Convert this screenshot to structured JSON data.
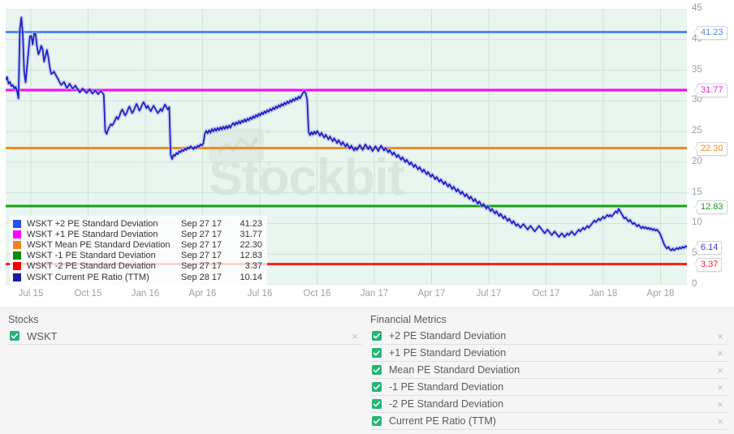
{
  "chart_data": {
    "type": "line",
    "title": "",
    "xlabel": "",
    "ylabel": "",
    "ylim": [
      0,
      45
    ],
    "y_ticks": [
      45,
      40,
      35,
      30,
      25,
      20,
      15,
      10,
      5,
      0
    ],
    "x_ticks": [
      "Jul 15",
      "Oct 15",
      "Jan 16",
      "Apr 16",
      "Jul 16",
      "Oct 16",
      "Jan 17",
      "Apr 17",
      "Jul 17",
      "Oct 17",
      "Jan 18",
      "Apr 18"
    ],
    "grid": true,
    "plot_background": "#e9f5ef",
    "legend_position": "inside-bottom-left",
    "watermark": "Stockbit",
    "reference_lines": [
      {
        "name": "WSKT +2 PE Standard Deviation",
        "value": 41.23,
        "color": "#4f86f7"
      },
      {
        "name": "WSKT +1 PE Standard Deviation",
        "value": 31.77,
        "color": "#ff00ff"
      },
      {
        "name": "WSKT Mean PE Standard Deviation",
        "value": 22.3,
        "color": "#f08a24"
      },
      {
        "name": "WSKT -1 PE Standard Deviation",
        "value": 12.83,
        "color": "#16a016"
      },
      {
        "name": "WSKT -2 PE Standard Deviation",
        "value": 3.37,
        "color": "#fa1f1f"
      }
    ],
    "series": [
      {
        "name": "WSKT Current PE Ratio (TTM)",
        "color": "#1f1fc8",
        "last_value": 6.14,
        "values": [
          33.4,
          33.9,
          32.8,
          33.1,
          32.4,
          32.6,
          32.0,
          32.3,
          31.6,
          30.4,
          41.8,
          43.6,
          41.0,
          34.8,
          33.0,
          35.5,
          38.0,
          40.5,
          40.6,
          39.2,
          41.0,
          40.9,
          38.9,
          37.6,
          38.1,
          39.0,
          38.4,
          36.4,
          37.4,
          38.3,
          37.1,
          35.5,
          34.4,
          34.5,
          34.8,
          34.3,
          33.9,
          33.5,
          33.0,
          32.6,
          32.8,
          33.1,
          32.6,
          32.1,
          32.4,
          32.8,
          32.4,
          32.0,
          32.2,
          32.5,
          32.1,
          31.8,
          31.4,
          31.6,
          32.0,
          31.8,
          31.5,
          31.3,
          31.6,
          31.9,
          31.5,
          31.2,
          31.4,
          31.7,
          31.4,
          31.1,
          31.4,
          31.6,
          31.3,
          31.0,
          25.0,
          24.6,
          25.3,
          25.8,
          26.2,
          26.0,
          26.4,
          26.9,
          27.4,
          27.0,
          27.5,
          28.2,
          28.6,
          28.1,
          27.6,
          28.0,
          28.6,
          29.1,
          28.5,
          28.0,
          28.4,
          29.0,
          29.5,
          29.0,
          28.4,
          28.8,
          29.4,
          29.8,
          29.3,
          28.8,
          29.2,
          28.7,
          28.3,
          28.8,
          29.2,
          28.8,
          28.4,
          28.0,
          28.3,
          28.7,
          28.3,
          28.9,
          29.4,
          29.0,
          28.6,
          29.0,
          21.2,
          20.5,
          21.2,
          21.0,
          21.5,
          21.3,
          21.8,
          21.6,
          22.0,
          21.8,
          22.2,
          22.0,
          22.4,
          22.2,
          22.6,
          22.4,
          22.1,
          22.5,
          22.3,
          22.7,
          22.5,
          22.9,
          22.7,
          23.1,
          24.6,
          25.1,
          24.7,
          25.2,
          24.8,
          25.4,
          25.0,
          25.5,
          25.1,
          25.6,
          25.2,
          25.7,
          25.3,
          25.8,
          25.4,
          25.9,
          25.5,
          26.0,
          25.6,
          26.1,
          26.4,
          26.0,
          26.5,
          26.2,
          26.7,
          26.3,
          26.8,
          26.5,
          27.0,
          26.6,
          27.1,
          26.8,
          27.3,
          27.0,
          27.5,
          27.2,
          27.7,
          27.4,
          27.9,
          27.6,
          28.1,
          27.8,
          28.3,
          28.0,
          28.5,
          28.2,
          28.7,
          28.4,
          28.9,
          28.6,
          29.1,
          28.8,
          29.3,
          29.0,
          29.5,
          29.2,
          29.7,
          29.4,
          29.9,
          29.6,
          30.1,
          29.8,
          30.3,
          30.0,
          30.5,
          30.2,
          30.7,
          30.4,
          30.9,
          31.3,
          31.6,
          31.2,
          30.2,
          24.9,
          24.4,
          24.9,
          24.5,
          25.0,
          24.6,
          25.1,
          24.7,
          24.3,
          24.8,
          24.4,
          24.0,
          24.5,
          24.1,
          23.7,
          24.2,
          23.8,
          23.4,
          23.9,
          23.5,
          23.1,
          23.6,
          23.2,
          22.8,
          23.3,
          22.9,
          22.5,
          23.0,
          22.6,
          22.2,
          22.7,
          22.3,
          21.9,
          22.4,
          22.0,
          22.4,
          22.8,
          22.4,
          22.0,
          22.5,
          22.9,
          22.5,
          22.1,
          22.6,
          22.2,
          21.8,
          22.2,
          22.6,
          22.2,
          21.8,
          22.3,
          22.7,
          22.3,
          21.9,
          22.3,
          22.0,
          21.6,
          22.0,
          21.6,
          21.2,
          21.6,
          21.2,
          20.8,
          21.2,
          20.8,
          20.4,
          20.8,
          20.4,
          20.0,
          20.4,
          20.0,
          19.6,
          20.0,
          19.6,
          19.2,
          19.6,
          19.2,
          18.8,
          19.2,
          18.8,
          18.4,
          18.8,
          18.4,
          18.0,
          18.4,
          18.0,
          17.6,
          18.0,
          17.6,
          17.2,
          17.6,
          17.2,
          16.8,
          17.2,
          16.8,
          16.4,
          16.8,
          16.4,
          16.0,
          16.4,
          16.0,
          15.6,
          16.0,
          15.6,
          15.2,
          15.6,
          15.2,
          14.8,
          15.2,
          14.8,
          14.4,
          14.8,
          14.4,
          14.0,
          14.4,
          14.0,
          13.6,
          14.0,
          13.6,
          13.2,
          13.6,
          13.2,
          12.8,
          13.2,
          12.8,
          12.4,
          12.8,
          12.4,
          12.0,
          12.4,
          12.0,
          11.6,
          12.0,
          11.6,
          11.2,
          11.6,
          11.2,
          10.8,
          11.2,
          10.8,
          10.4,
          10.8,
          10.4,
          10.0,
          10.4,
          10.0,
          9.6,
          9.9,
          9.6,
          9.3,
          9.6,
          9.9,
          9.6,
          9.3,
          9.0,
          9.3,
          9.6,
          9.3,
          9.0,
          8.7,
          9.0,
          9.3,
          9.6,
          9.3,
          9.0,
          8.7,
          8.4,
          8.7,
          9.0,
          8.7,
          8.4,
          8.1,
          8.4,
          8.7,
          8.4,
          8.1,
          7.8,
          8.1,
          8.4,
          8.1,
          7.8,
          8.1,
          8.4,
          8.1,
          8.4,
          8.7,
          8.4,
          8.1,
          8.4,
          8.7,
          9.0,
          8.7,
          9.0,
          9.3,
          9.0,
          9.3,
          9.6,
          9.3,
          9.6,
          9.9,
          10.2,
          10.5,
          10.2,
          10.5,
          10.8,
          10.5,
          10.8,
          11.1,
          10.8,
          11.1,
          11.4,
          11.1,
          11.4,
          11.1,
          11.4,
          11.7,
          12.0,
          11.7,
          12.4,
          12.0,
          11.6,
          11.2,
          10.8,
          11.0,
          10.6,
          10.3,
          10.6,
          10.2,
          9.9,
          10.1,
          9.8,
          9.5,
          9.8,
          9.5,
          9.2,
          9.5,
          9.2,
          9.4,
          9.1,
          9.3,
          9.0,
          9.2,
          8.9,
          9.1,
          8.8,
          9.0,
          8.7,
          8.4,
          7.8,
          7.2,
          6.6,
          6.2,
          5.9,
          6.2,
          5.8,
          5.6,
          5.9,
          5.6,
          5.8,
          6.0,
          5.8,
          6.1,
          5.9,
          6.2,
          6.0,
          6.3,
          6.14
        ]
      }
    ]
  },
  "value_tags": [
    {
      "label": "41.23",
      "color": "#4f86f7",
      "value": 41.23
    },
    {
      "label": "31.77",
      "color": "#e31ee3",
      "value": 31.77
    },
    {
      "label": "22.30",
      "color": "#f08a24",
      "value": 22.3
    },
    {
      "label": "12.83",
      "color": "#16a016",
      "value": 12.83
    },
    {
      "label": "6.14",
      "color": "#3a3ad8",
      "value": 6.14
    },
    {
      "label": "3.37",
      "color": "#fa1f1f",
      "value": 3.37
    }
  ],
  "legend": {
    "rows": [
      {
        "swatch": "#2255ee",
        "name": "WSKT +2 PE Standard Deviation",
        "date": "Sep 27 17",
        "value": "41.23"
      },
      {
        "swatch": "#ff00ff",
        "name": "WSKT +1 PE Standard Deviation",
        "date": "Sep 27 17",
        "value": "31.77"
      },
      {
        "swatch": "#f58220",
        "name": "WSKT Mean PE Standard Deviation",
        "date": "Sep 27 17",
        "value": "22.30"
      },
      {
        "swatch": "#0a8a0a",
        "name": "WSKT -1 PE Standard Deviation",
        "date": "Sep 27 17",
        "value": "12.83"
      },
      {
        "swatch": "#f50000",
        "name": "WSKT -2 PE Standard Deviation",
        "date": "Sep 27 17",
        "value": "3.37"
      },
      {
        "swatch": "#1a1aa8",
        "name": "WSKT Current PE Ratio (TTM)",
        "date": "Sep 28 17",
        "value": "10.14"
      }
    ]
  },
  "panels": {
    "stocks": {
      "title": "Stocks",
      "items": [
        {
          "label": "WSKT",
          "checked": true,
          "remove": "×"
        }
      ]
    },
    "metrics": {
      "title": "Financial Metrics",
      "items": [
        {
          "label": "+2 PE Standard Deviation",
          "checked": true,
          "remove": "×"
        },
        {
          "label": "+1 PE Standard Deviation",
          "checked": true,
          "remove": "×"
        },
        {
          "label": "Mean PE Standard Deviation",
          "checked": true,
          "remove": "×"
        },
        {
          "label": "-1 PE Standard Deviation",
          "checked": true,
          "remove": "×"
        },
        {
          "label": "-2 PE Standard Deviation",
          "checked": true,
          "remove": "×"
        },
        {
          "label": "Current PE Ratio (TTM)",
          "checked": true,
          "remove": "×"
        }
      ]
    }
  },
  "colors": {
    "plot_bg": "#e9f5ef",
    "grid": "#cfe3d8",
    "panel_bg": "#f5f5f5",
    "checkbox": "#22b573",
    "axis_text": "#9aa0a6"
  }
}
